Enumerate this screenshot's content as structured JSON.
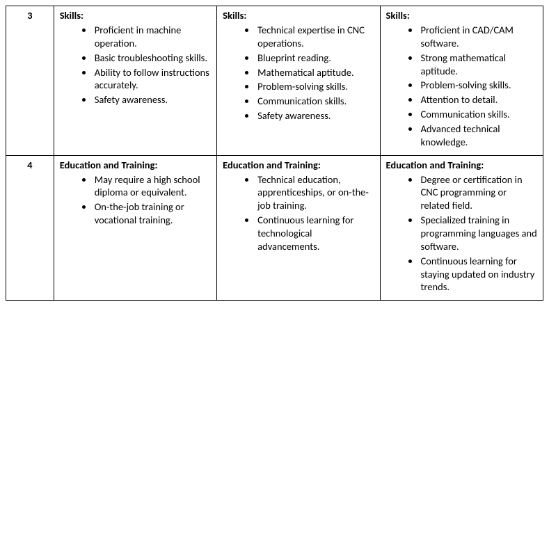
{
  "rows": [
    {
      "num": "3",
      "cols": [
        {
          "heading": "Skills:",
          "items": [
            "Proficient in machine operation.",
            "Basic troubleshooting skills.",
            "Ability to follow instructions accurately.",
            "Safety awareness."
          ]
        },
        {
          "heading": "Skills:",
          "items": [
            "Technical expertise in CNC operations.",
            "Blueprint reading.",
            "Mathematical aptitude.",
            "Problem-solving skills.",
            "Communication skills.",
            "Safety awareness."
          ]
        },
        {
          "heading": "Skills:",
          "items": [
            "Proficient in CAD/CAM software.",
            "Strong mathematical aptitude.",
            "Problem-solving skills.",
            "Attention to detail.",
            "Communication skills.",
            "Advanced technical knowledge."
          ]
        }
      ]
    },
    {
      "num": "4",
      "cols": [
        {
          "heading": "Education and Training:",
          "items": [
            "May require a high school diploma or equivalent.",
            "On-the-job training or vocational training."
          ]
        },
        {
          "heading": "Education and Training:",
          "items": [
            "Technical education, apprenticeships, or on-the-job training.",
            "Continuous learning for technological advancements."
          ]
        },
        {
          "heading": "Education and Training:",
          "items": [
            "Degree or certification in CNC programming or related field.",
            "Specialized training in programming languages and software.",
            "Continuous learning for staying updated on industry trends."
          ]
        }
      ]
    }
  ]
}
